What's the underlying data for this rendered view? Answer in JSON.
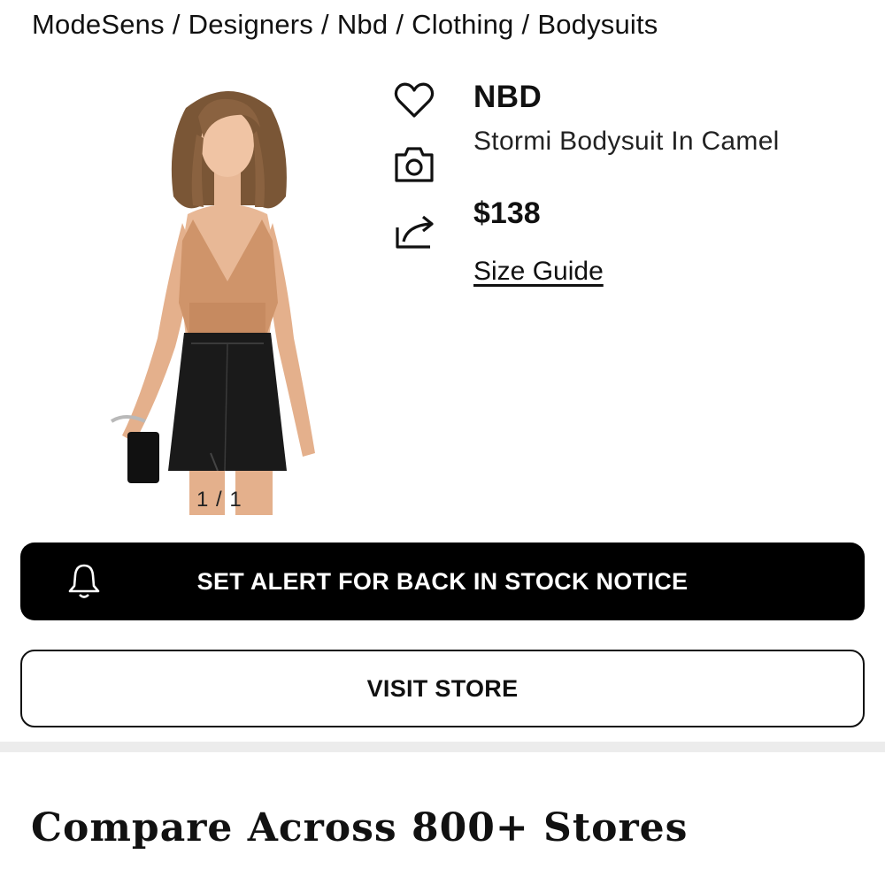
{
  "breadcrumb": {
    "items": [
      "ModeSens",
      "Designers",
      "Nbd",
      "Clothing",
      "Bodysuits"
    ],
    "separator": "/"
  },
  "gallery": {
    "counter": "1 / 1"
  },
  "actions": {
    "favorite_icon": "heart-icon",
    "visual_search_icon": "camera-icon",
    "share_icon": "share-icon"
  },
  "product": {
    "brand": "NBD",
    "name": "Stormi Bodysuit In Camel",
    "price": "$138",
    "size_guide_label": "Size Guide"
  },
  "buttons": {
    "alert_label": "SET ALERT FOR BACK IN STOCK NOTICE",
    "alert_icon": "bell-icon",
    "visit_label": "VISIT STORE"
  },
  "compare": {
    "title": "Compare Across 800+ Stores"
  },
  "colors": {
    "primary_button_bg": "#000000",
    "primary_button_text": "#ffffff",
    "divider": "#ececec"
  }
}
